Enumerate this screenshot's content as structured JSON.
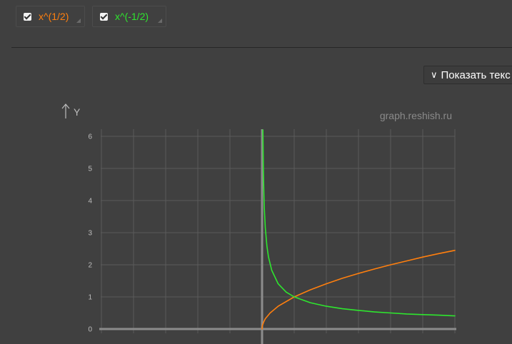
{
  "toolbar": {
    "series_toggles": [
      {
        "label": "x^(1/2)",
        "checked": true,
        "color": "#ff7f0e"
      },
      {
        "label": "x^(-1/2)",
        "checked": true,
        "color": "#2ee62e"
      }
    ]
  },
  "show_text_button": {
    "label": "Показать текс",
    "icon": "chevron-down-icon"
  },
  "watermark": "graph.reshish.ru",
  "chart_data": {
    "type": "line",
    "title": "",
    "xlabel": "",
    "ylabel": "Y",
    "ylim": [
      0,
      6.2
    ],
    "xlim": [
      -5,
      6
    ],
    "y_ticks": [
      "0",
      "1",
      "2",
      "3",
      "4",
      "5",
      "6"
    ],
    "grid": true,
    "legend": "none",
    "series": [
      {
        "name": "x^(1/2)",
        "color": "#ff7f0e",
        "x": [
          0,
          0.01,
          0.05,
          0.1,
          0.25,
          0.5,
          1,
          1.5,
          2,
          2.5,
          3,
          3.5,
          4,
          4.5,
          5,
          5.5,
          6
        ],
        "y": [
          0,
          0.1,
          0.22,
          0.32,
          0.5,
          0.71,
          1,
          1.22,
          1.41,
          1.58,
          1.73,
          1.87,
          2,
          2.12,
          2.24,
          2.35,
          2.45
        ]
      },
      {
        "name": "x^(-1/2)",
        "color": "#2ee62e",
        "x": [
          0.026,
          0.03,
          0.04,
          0.05,
          0.07,
          0.1,
          0.15,
          0.2,
          0.3,
          0.5,
          0.75,
          1,
          1.5,
          2,
          2.5,
          3,
          3.5,
          4,
          4.5,
          5,
          5.5,
          6
        ],
        "y": [
          6.2,
          5.77,
          5,
          4.47,
          3.78,
          3.16,
          2.58,
          2.24,
          1.83,
          1.41,
          1.15,
          1,
          0.82,
          0.71,
          0.63,
          0.58,
          0.53,
          0.5,
          0.47,
          0.45,
          0.43,
          0.41
        ]
      }
    ]
  }
}
